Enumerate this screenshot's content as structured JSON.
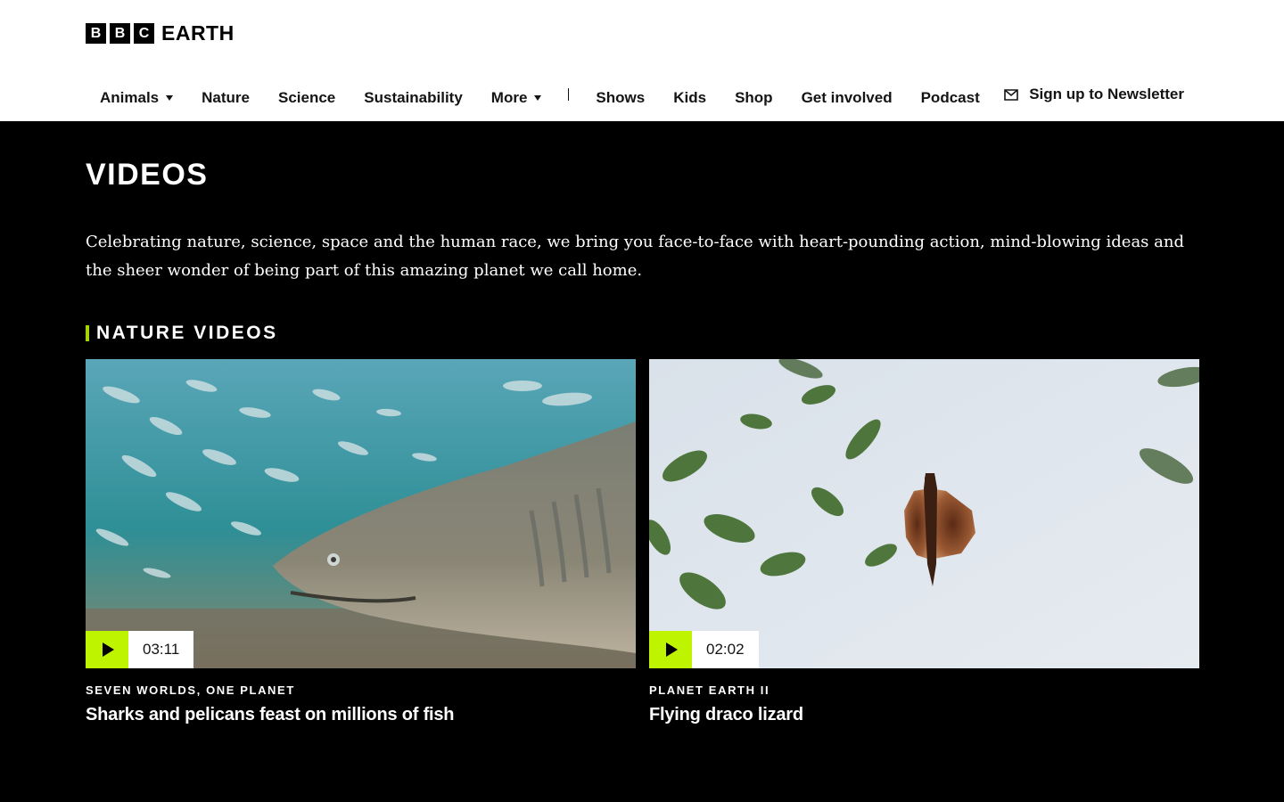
{
  "header": {
    "logo": {
      "letters": [
        "B",
        "B",
        "C"
      ],
      "word": "EARTH"
    },
    "nav": [
      {
        "label": "Animals",
        "dropdown": true
      },
      {
        "label": "Nature",
        "dropdown": false
      },
      {
        "label": "Science",
        "dropdown": false
      },
      {
        "label": "Sustainability",
        "dropdown": false
      },
      {
        "label": "More",
        "dropdown": true
      },
      {
        "label": "Shows",
        "dropdown": false
      },
      {
        "label": "Kids",
        "dropdown": false
      },
      {
        "label": "Shop",
        "dropdown": false
      },
      {
        "label": "Get involved",
        "dropdown": false
      },
      {
        "label": "Podcast",
        "dropdown": false
      }
    ],
    "newsletter": {
      "label": "Sign up to Newsletter",
      "icon": "envelope-icon"
    }
  },
  "main": {
    "title": "VIDEOS",
    "intro": "Celebrating nature, science, space and the human race, we bring you face-to-face with heart-pounding action, mind-blowing ideas and the sheer wonder of being part of this amazing planet we call home.",
    "section": {
      "title": "NATURE VIDEOS",
      "accent": "#a6d400"
    },
    "cards": [
      {
        "duration": "03:11",
        "series": "SEVEN WORLDS, ONE PLANET",
        "title": "Sharks and pelicans feast on millions of fish"
      },
      {
        "duration": "02:02",
        "series": "PLANET EARTH II",
        "title": "Flying draco lizard"
      }
    ]
  },
  "colors": {
    "background": "#000000",
    "header_bg": "#ffffff",
    "play_button": "#bff400",
    "section_accent": "#a6d400"
  }
}
